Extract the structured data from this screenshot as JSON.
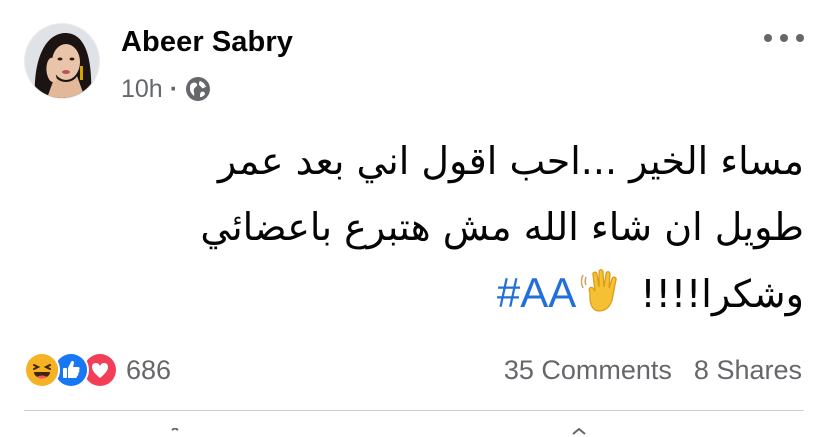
{
  "post": {
    "author": "Abeer Sabry",
    "time": "10h",
    "separator": "·",
    "privacy_icon": "globe-icon",
    "more_icon": "more-options-icon",
    "text_lines": [
      "مساء الخير ...احب اقول اني بعد عمر",
      "طويل ان شاء الله مش هتبرع باعضائي",
      "وشكرا!!!!"
    ],
    "hashtag": "#AA",
    "emoji": "waving-hand-icon"
  },
  "footer": {
    "reaction_icons": [
      "haha-icon",
      "like-icon",
      "love-icon"
    ],
    "reaction_count": "686",
    "comments": "35 Comments",
    "shares": "8 Shares"
  },
  "colors": {
    "text": "#050505",
    "secondary": "#65676b",
    "link": "#216fdb",
    "like": "#1877f2",
    "love": "#f33e58",
    "haha": "#f7b125",
    "divider": "#ced0d4"
  }
}
